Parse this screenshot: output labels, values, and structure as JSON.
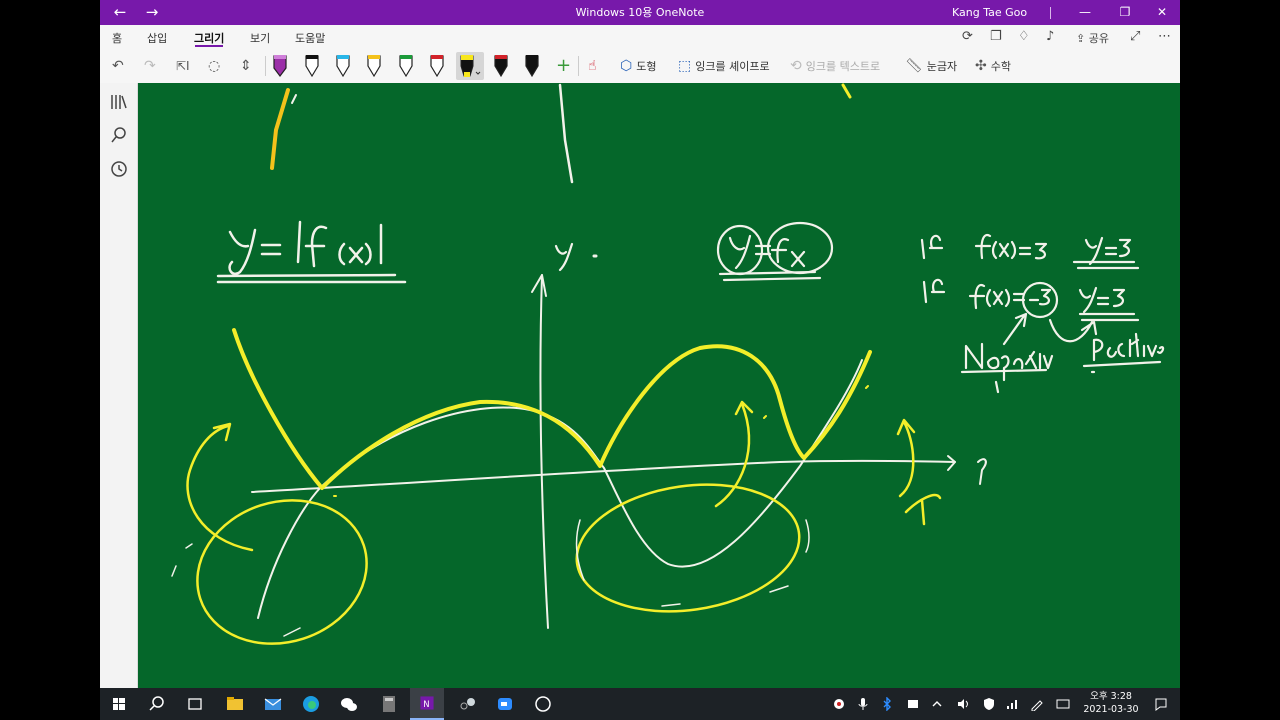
{
  "window": {
    "title": "Windows 10용 OneNote",
    "user": "Kang Tae Goo",
    "nav_back": "←",
    "nav_forward": "→",
    "minimize": "—",
    "restore": "❐",
    "close": "✕"
  },
  "menu": {
    "tabs": [
      "홈",
      "삽입",
      "그리기",
      "보기",
      "도움말"
    ],
    "active_tab": "그리기",
    "share_label": "공유"
  },
  "toolbar": {
    "shapes_label": "도형",
    "ink_to_shape_label": "잉크를 셰이프로",
    "ink_to_text_label": "잉크를 텍스트로",
    "ruler_label": "눈금자",
    "math_label": "수학",
    "pens": [
      {
        "name": "pen-purple",
        "color": "#9b2fa8"
      },
      {
        "name": "pen-black",
        "color": "#111111"
      },
      {
        "name": "pen-cyan",
        "color": "#29b6e8"
      },
      {
        "name": "pen-yellow",
        "color": "#f4c21b"
      },
      {
        "name": "pen-green",
        "color": "#1c9b3a"
      },
      {
        "name": "pen-red",
        "color": "#d2232a"
      },
      {
        "name": "highlighter-yellow",
        "color": "#f8e71c"
      },
      {
        "name": "pen-red-2",
        "color": "#d2232a"
      },
      {
        "name": "pen-black-2",
        "color": "#111111"
      }
    ],
    "selected_pen": "highlighter-yellow"
  },
  "canvas": {
    "background": "#05672a",
    "ink_white": "#f2f2ea",
    "ink_yellow": "#f3ee2a"
  },
  "taskbar": {
    "time": "오후 3:28",
    "date": "2021-03-30"
  }
}
